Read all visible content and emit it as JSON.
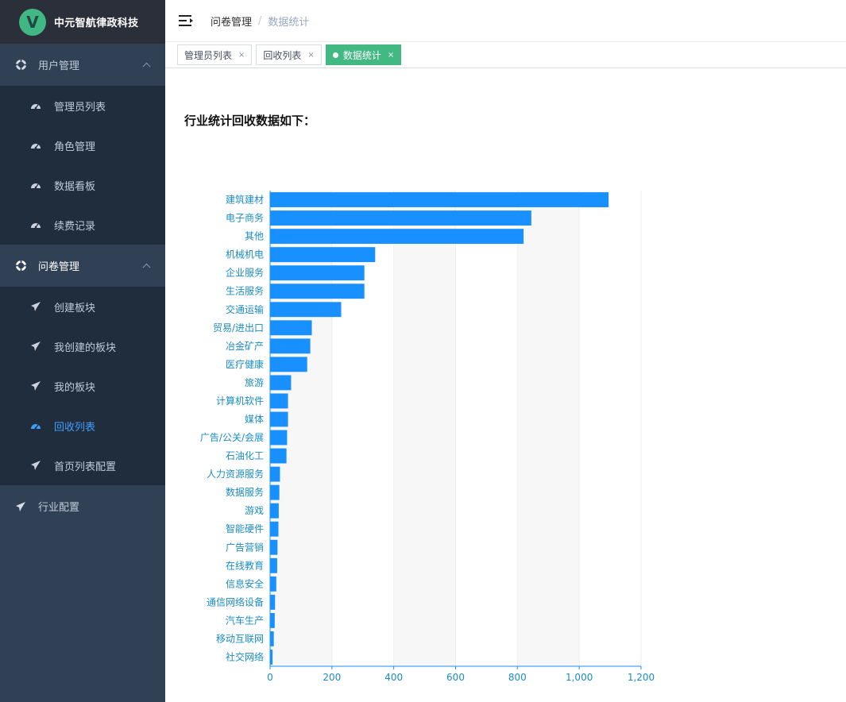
{
  "app": {
    "name": "中元智航律政科技",
    "logo_letter": "V"
  },
  "sidebar": {
    "groups": [
      {
        "title": "用户管理",
        "items": [
          "管理员列表",
          "角色管理",
          "数据看板",
          "续费记录"
        ]
      },
      {
        "title": "问卷管理",
        "items": [
          "创建板块",
          "我创建的板块",
          "我的板块",
          "回收列表",
          "首页列表配置"
        ]
      },
      {
        "title": "行业配置",
        "items": []
      }
    ],
    "active_item": "回收列表"
  },
  "breadcrumb": {
    "parent": "问卷管理",
    "separator": "/",
    "current": "数据统计"
  },
  "tags": [
    {
      "label": "管理员列表",
      "close": "×"
    },
    {
      "label": "回收列表",
      "close": "×"
    },
    {
      "label": "数据统计",
      "close": "×",
      "active": true
    }
  ],
  "content": {
    "title": "行业统计回收数据如下："
  },
  "colors": {
    "bar": "#1890ff",
    "axis": "#1890ff",
    "label": "#1a8cc4",
    "tag_active": "#42b983",
    "sidebar": "#304156"
  },
  "chart_data": {
    "type": "bar",
    "orientation": "horizontal",
    "categories": [
      "建筑建材",
      "电子商务",
      "其他",
      "机械机电",
      "企业服务",
      "生活服务",
      "交通运输",
      "贸易/进出口",
      "冶金矿产",
      "医疗健康",
      "旅游",
      "计算机软件",
      "媒体",
      "广告/公关/会展",
      "石油化工",
      "人力资源服务",
      "数据服务",
      "游戏",
      "智能硬件",
      "广告营销",
      "在线教育",
      "信息安全",
      "通信网络设备",
      "汽车生产",
      "移动互联网",
      "社交网络"
    ],
    "values": [
      1095,
      845,
      820,
      340,
      305,
      305,
      230,
      135,
      130,
      120,
      68,
      58,
      58,
      55,
      53,
      32,
      30,
      28,
      27,
      24,
      23,
      20,
      16,
      15,
      12,
      8
    ],
    "xlim": [
      0,
      1200
    ],
    "xticks": [
      "0",
      "200",
      "400",
      "600",
      "800",
      "1,000",
      "1,200"
    ],
    "grid": "vertical-bands"
  }
}
